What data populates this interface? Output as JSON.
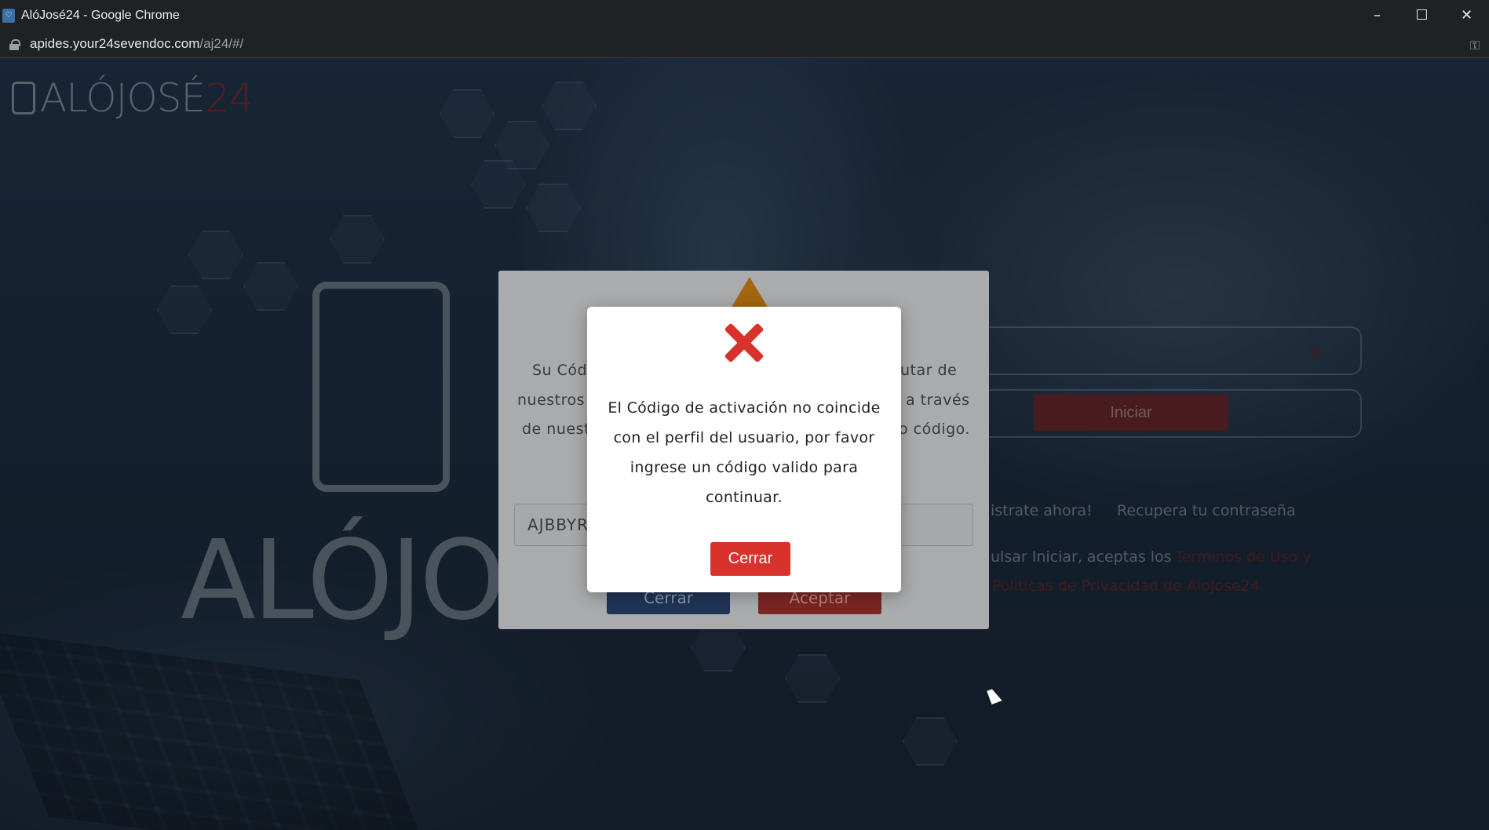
{
  "window": {
    "title": "AlóJosé24 - Google Chrome",
    "minimize": "–",
    "maximize": "☐",
    "close": "✕"
  },
  "address": {
    "domain": "apides.your24sevendoc.com",
    "path": "/aj24/#/"
  },
  "brand": {
    "name_prefix": "ALÓJOSÉ",
    "name_number": "24",
    "big_word": "ALÓJOSÉ"
  },
  "login_form": {
    "submit_label": "Iniciar",
    "register_label": "istrate ahora!",
    "recover_label": "Recupera tu contraseña",
    "terms_prefix": "ulsar Iniciar, aceptas los",
    "terms_link": "Terminos de Uso y",
    "privacy_link": "Politicas de Privacidad de AloJose24"
  },
  "activation_modal": {
    "line1_left": "Su Códi",
    "line1_right": "utar de",
    "line2_left": "nuestros",
    "line2_right": "a través",
    "line3_left": "de nuest",
    "line3_right": "o código.",
    "code_value": "AJBBYR",
    "cancel_label": "Cerrar",
    "accept_label": "Aceptar"
  },
  "error_modal": {
    "message": "El Código de activación no coincide con el perfil del usuario, por favor ingrese un código valido para continuar.",
    "close_label": "Cerrar"
  }
}
